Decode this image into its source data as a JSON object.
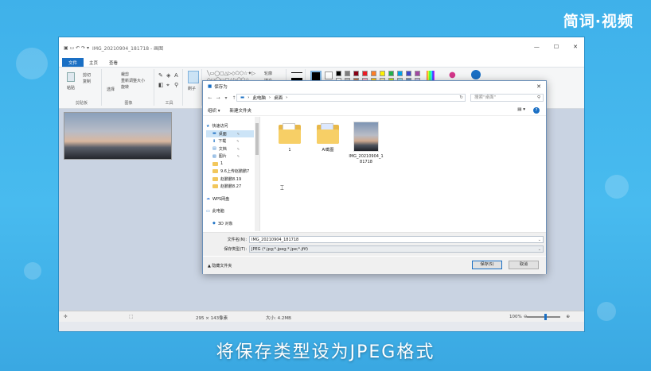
{
  "brand": "简词·视频",
  "caption": "将保存类型设为JPEG格式",
  "window": {
    "title": "IMG_20210904_181718 - 画图",
    "minimize": "—",
    "maximize": "☐",
    "close": "✕"
  },
  "menu": {
    "file": "文件",
    "home": "主页",
    "view": "查看"
  },
  "ribbon": {
    "paste": "粘贴",
    "cut": "剪切",
    "copy": "复制",
    "clipboard": "剪贴板",
    "crop": "裁剪",
    "resize": "重新调整大小",
    "rotate": "旋转",
    "select": "选择",
    "image": "图像",
    "tools": "工具",
    "brush": "刷子",
    "outline": "轮廓",
    "fill": "填充"
  },
  "palette": [
    "#000000",
    "#7f7f7f",
    "#880015",
    "#ed1c24",
    "#ff7f27",
    "#fff200",
    "#22b14c",
    "#00a2e8",
    "#3f48cc",
    "#a349a4",
    "#ffffff",
    "#c3c3c3",
    "#b97a57",
    "#ffaec9",
    "#ffc90e",
    "#efe4b0",
    "#b5e61d",
    "#99d9ea",
    "#7092be",
    "#c8bfe7"
  ],
  "status": {
    "size": "295 × 143像素",
    "filesize": "大小: 4.2MB",
    "zoom": "100%"
  },
  "dialog": {
    "title": "保存为",
    "close": "✕",
    "path": [
      "此电脑",
      "桌面"
    ],
    "search_placeholder": "搜索\"桌面\"",
    "organize": "组织 ▾",
    "new_folder": "新建文件夹",
    "nav": [
      {
        "label": "快速访问",
        "type": "star"
      },
      {
        "label": "桌面",
        "type": "desktop",
        "selected": true
      },
      {
        "label": "下载",
        "type": "download"
      },
      {
        "label": "文档",
        "type": "doc"
      },
      {
        "label": "图片",
        "type": "pic"
      },
      {
        "label": "1",
        "type": "folder"
      },
      {
        "label": "9.6上传赵鹏鹏7",
        "type": "folder"
      },
      {
        "label": "赵鹏鹏8.19",
        "type": "folder"
      },
      {
        "label": "赵鹏鹏8.27",
        "type": "folder"
      },
      {
        "label": "WPS网盘",
        "type": "cloud"
      },
      {
        "label": "此电脑",
        "type": "pc"
      },
      {
        "label": "3D 对象",
        "type": "3d"
      }
    ],
    "files": [
      {
        "name": "1",
        "kind": "folder"
      },
      {
        "name": "AI截图",
        "kind": "folder"
      },
      {
        "name": "IMG_20210904_181718",
        "kind": "image"
      }
    ],
    "filename_label": "文件名(N):",
    "filename": "IMG_20210904_181718",
    "filetype_label": "保存类型(T):",
    "filetype": "JPEG (*.jpg;*.jpeg;*.jpe;*.jfif)",
    "hide_folders": "▲ 隐藏文件夹",
    "save": "保存(S)",
    "cancel": "取消"
  }
}
